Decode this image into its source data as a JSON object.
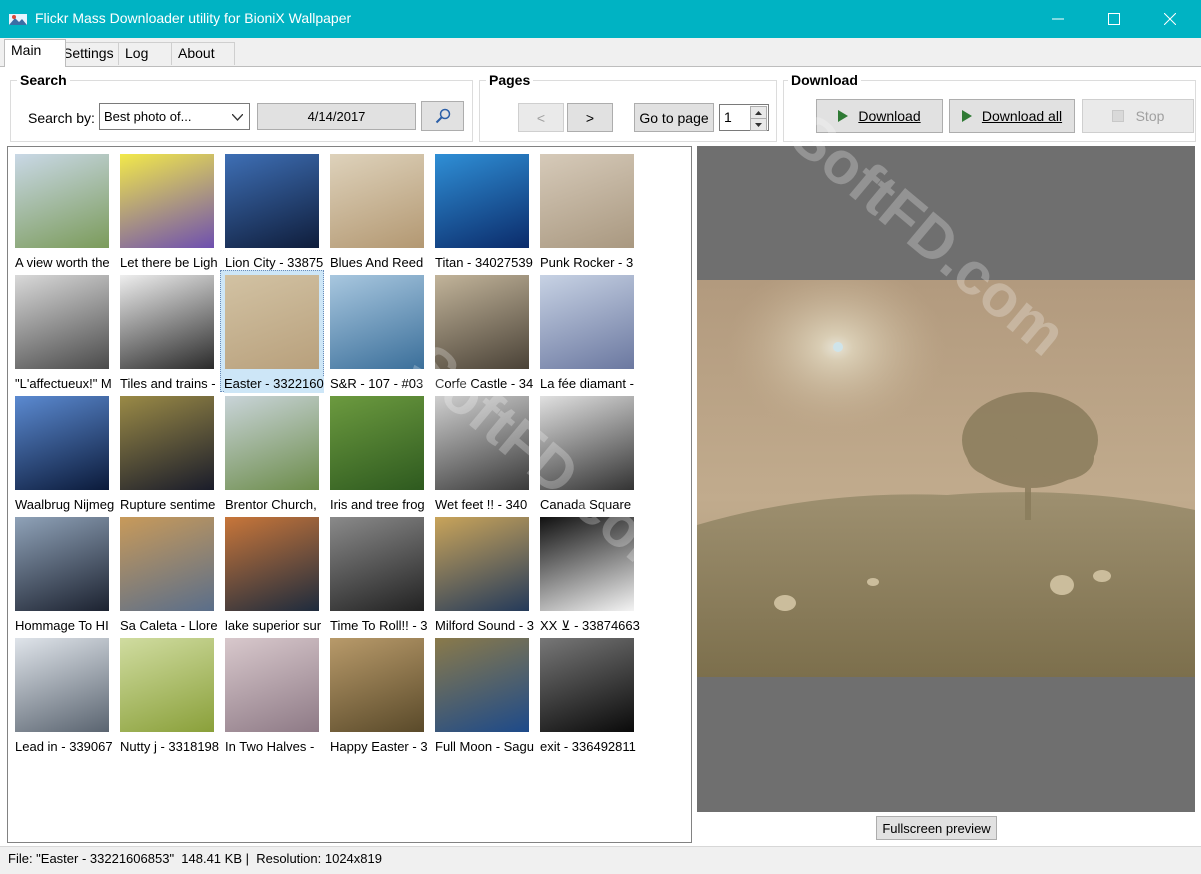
{
  "window": {
    "title": "Flickr Mass Downloader utility for BioniX Wallpaper"
  },
  "tabs": [
    "Main",
    "Settings",
    "Log",
    "About"
  ],
  "search": {
    "group_label": "Search",
    "label": "Search by:",
    "mode": "Best photo of...",
    "date": "4/14/2017"
  },
  "pages": {
    "group_label": "Pages",
    "prev": "<",
    "next": ">",
    "goto_label": "Go to page",
    "page_value": "1"
  },
  "download": {
    "group_label": "Download",
    "download_label": "Download",
    "download_all_label": "Download all",
    "stop_label": "Stop"
  },
  "thumbnails": [
    {
      "caption": "A view worth the"
    },
    {
      "caption": "Let there be Ligh"
    },
    {
      "caption": "Lion City - 33875"
    },
    {
      "caption": "Blues And Reed"
    },
    {
      "caption": "Titan - 34027539"
    },
    {
      "caption": "Punk Rocker - 3"
    },
    {
      "caption": "\"L'affectueux!\" M"
    },
    {
      "caption": "Tiles and trains -"
    },
    {
      "caption": "Easter - 3322160"
    },
    {
      "caption": "S&R - 107 - #03"
    },
    {
      "caption": "Corfe Castle - 34"
    },
    {
      "caption": "La fée diamant -"
    },
    {
      "caption": "Waalbrug Nijmeg"
    },
    {
      "caption": "Rupture sentime"
    },
    {
      "caption": "Brentor Church,"
    },
    {
      "caption": "Iris and tree frog"
    },
    {
      "caption": "Wet feet !! - 340"
    },
    {
      "caption": "Canada Square"
    },
    {
      "caption": "Hommage To HI"
    },
    {
      "caption": "Sa Caleta - Llore"
    },
    {
      "caption": "lake superior sur"
    },
    {
      "caption": "Time To Roll!! - 3"
    },
    {
      "caption": "Milford Sound - 3"
    },
    {
      "caption": "XX ⊻ - 33874663"
    },
    {
      "caption": "Lead in - 339067"
    },
    {
      "caption": "Nutty j - 3318198"
    },
    {
      "caption": "In Two Halves -"
    },
    {
      "caption": "Happy Easter - 3"
    },
    {
      "caption": "Full Moon - Sagu"
    },
    {
      "caption": "exit - 336492811"
    }
  ],
  "selected_index": 8,
  "preview": {
    "fullscreen_label": "Fullscreen preview"
  },
  "status": {
    "text": "File: \"Easter - 33221606853\"  148.41 KB |  Resolution: 1024x819"
  },
  "watermark": "SoftFD.com",
  "colors": {
    "titlebar": "#00b3c3",
    "selection": "#cde6f7",
    "preview_bg": "#6f6f6f"
  }
}
